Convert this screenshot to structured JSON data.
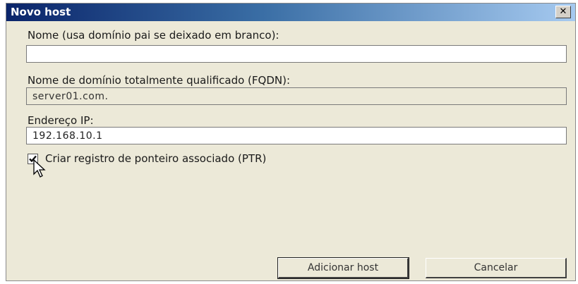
{
  "dialog": {
    "title": "Novo host",
    "close_label": "✕"
  },
  "form": {
    "name_label": "Nome (usa domínio pai se deixado em branco):",
    "name_value": "",
    "fqdn_label": "Nome de domínio totalmente qualificado (FQDN):",
    "fqdn_value": "server01.com.",
    "ip_label": "Endereço IP:",
    "ip_value": "192.168.10.1",
    "ptr_label": "Criar registro de ponteiro associado (PTR)",
    "ptr_checked": true
  },
  "buttons": {
    "add_label": "Adicionar host",
    "cancel_label": "Cancelar"
  },
  "colors": {
    "titlebar_start": "#0a246a",
    "titlebar_end": "#a6caf0",
    "dialog_bg": "#ece9d8"
  }
}
